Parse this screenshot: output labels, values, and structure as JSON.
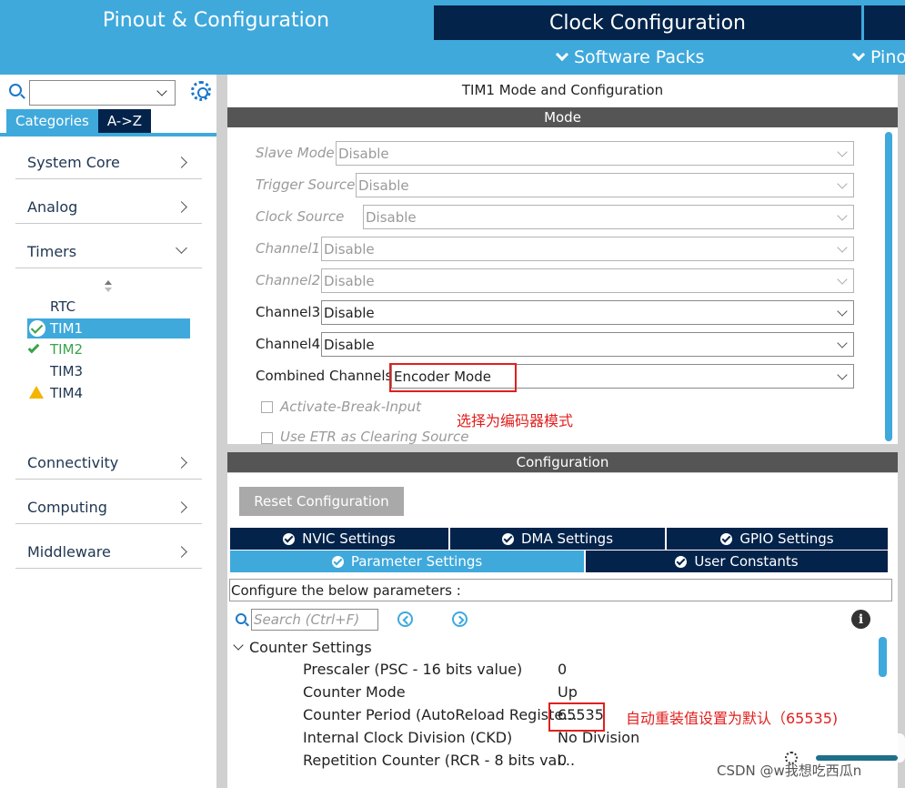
{
  "header": {
    "tabs": [
      {
        "label": "Pinout & Configuration",
        "active": true
      },
      {
        "label": "Clock Configuration",
        "active": false
      }
    ],
    "submenu": [
      {
        "label": "Software Packs"
      },
      {
        "label": "Pino"
      }
    ]
  },
  "sidebar": {
    "search": {
      "value": ""
    },
    "tabs": [
      "Categories",
      "A->Z"
    ],
    "categories": [
      {
        "label": "System Core"
      },
      {
        "label": "Analog"
      },
      {
        "label": "Timers"
      },
      {
        "label": "Connectivity"
      },
      {
        "label": "Computing"
      },
      {
        "label": "Middleware"
      }
    ],
    "timers": [
      {
        "label": "RTC",
        "status": "none"
      },
      {
        "label": "TIM1",
        "status": "ok-selected"
      },
      {
        "label": "TIM2",
        "status": "ok"
      },
      {
        "label": "TIM3",
        "status": "none"
      },
      {
        "label": "TIM4",
        "status": "warning"
      }
    ]
  },
  "main": {
    "title": "TIM1 Mode and Configuration",
    "mode_header": "Mode",
    "mode_fields": [
      {
        "label": "Slave Mode",
        "value": "Disable",
        "enabled": false
      },
      {
        "label": "Trigger Source",
        "value": "Disable",
        "enabled": false
      },
      {
        "label": "Clock Source",
        "value": "Disable",
        "enabled": false
      },
      {
        "label": "Channel1",
        "value": "Disable",
        "enabled": false
      },
      {
        "label": "Channel2",
        "value": "Disable",
        "enabled": false
      },
      {
        "label": "Channel3",
        "value": "Disable",
        "enabled": true
      },
      {
        "label": "Channel4",
        "value": "Disable",
        "enabled": true
      },
      {
        "label": "Combined Channels",
        "value": "Encoder Mode",
        "enabled": true
      }
    ],
    "checkboxes": [
      {
        "label": "Activate-Break-Input",
        "checked": false
      },
      {
        "label": "Use ETR as Clearing Source",
        "checked": false
      }
    ],
    "annotation_mode": "选择为编码器模式",
    "config_header": "Configuration",
    "reset_label": "Reset Configuration",
    "param_tabs_row1": [
      "NVIC Settings",
      "DMA Settings",
      "GPIO Settings"
    ],
    "param_tabs_row2": [
      "Parameter Settings",
      "User Constants"
    ],
    "config_desc": "Configure the below parameters :",
    "search_placeholder": "Search (Ctrl+F)",
    "group_title": "Counter Settings",
    "params": [
      {
        "name": "Prescaler (PSC - 16 bits value)",
        "value": "0"
      },
      {
        "name": "Counter Mode",
        "value": "Up"
      },
      {
        "name": "Counter Period (AutoReload Registe...",
        "value": "65535"
      },
      {
        "name": "Internal Clock Division (CKD)",
        "value": "No Division"
      },
      {
        "name": "Repetition Counter (RCR - 8 bits val...",
        "value": "0"
      }
    ],
    "annotation_period": "自动重装值设置为默认（65535)"
  },
  "watermark": "CSDN @w我想吃西瓜n",
  "colors": {
    "accent": "#3fa9dc",
    "navy": "#03234b",
    "annotation": "#e0201e"
  }
}
